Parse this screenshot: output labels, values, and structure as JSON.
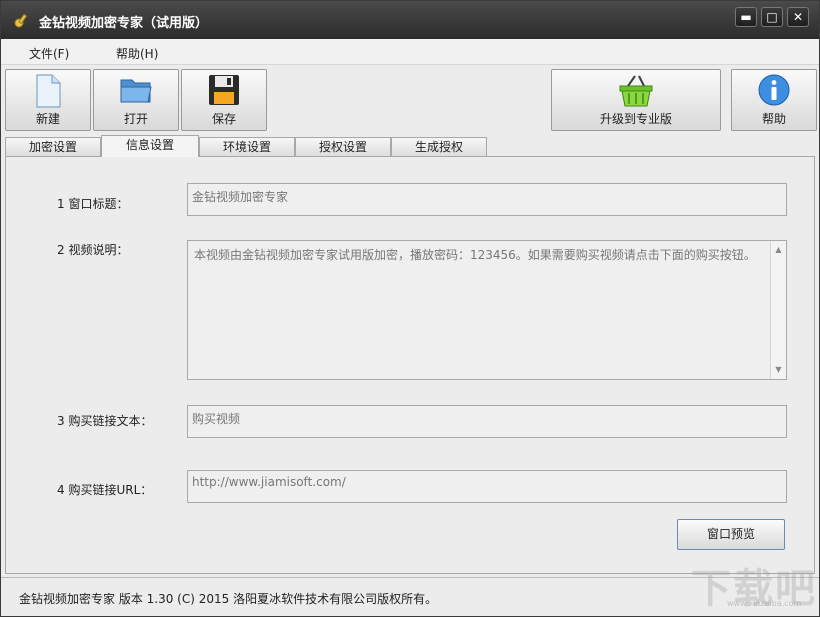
{
  "window": {
    "title": "金钻视频加密专家（试用版）",
    "controls": {
      "minimize": "▬",
      "maximize": "□",
      "close": "✕"
    }
  },
  "menu": {
    "file": "文件(F)",
    "help": "帮助(H)"
  },
  "toolbar": {
    "new_label": "新建",
    "open_label": "打开",
    "save_label": "保存",
    "upgrade_label": "升级到专业版",
    "help_label": "帮助"
  },
  "tabs": [
    {
      "label": "加密设置",
      "active": false
    },
    {
      "label": "信息设置",
      "active": true
    },
    {
      "label": "环境设置",
      "active": false
    },
    {
      "label": "授权设置",
      "active": false
    },
    {
      "label": "生成授权",
      "active": false
    }
  ],
  "form": {
    "window_title_label": "1 窗口标题：",
    "window_title_value": "金钻视频加密专家",
    "video_desc_label": "2 视频说明：",
    "video_desc_value": "本视频由金钻视频加密专家试用版加密，播放密码：123456。如果需要购买视频请点击下面的购买按钮。",
    "buy_link_text_label": "3 购买链接文本：",
    "buy_link_text_value": "购买视频",
    "buy_link_url_label": "4 购买链接URL：",
    "buy_link_url_value": "http://www.jiamisoft.com/",
    "preview_button": "窗口预览"
  },
  "status": {
    "text": "金钻视频加密专家  版本 1.30 (C)  2015 洛阳夏冰软件技术有限公司版权所有。"
  },
  "watermark": {
    "main": "下载吧",
    "sub": "www.xiazaiba.com"
  },
  "icons": {
    "app": "key-icon",
    "new": "new-document-icon",
    "open": "folder-icon",
    "save": "floppy-disk-icon",
    "upgrade": "shopping-basket-icon",
    "help": "info-icon"
  }
}
